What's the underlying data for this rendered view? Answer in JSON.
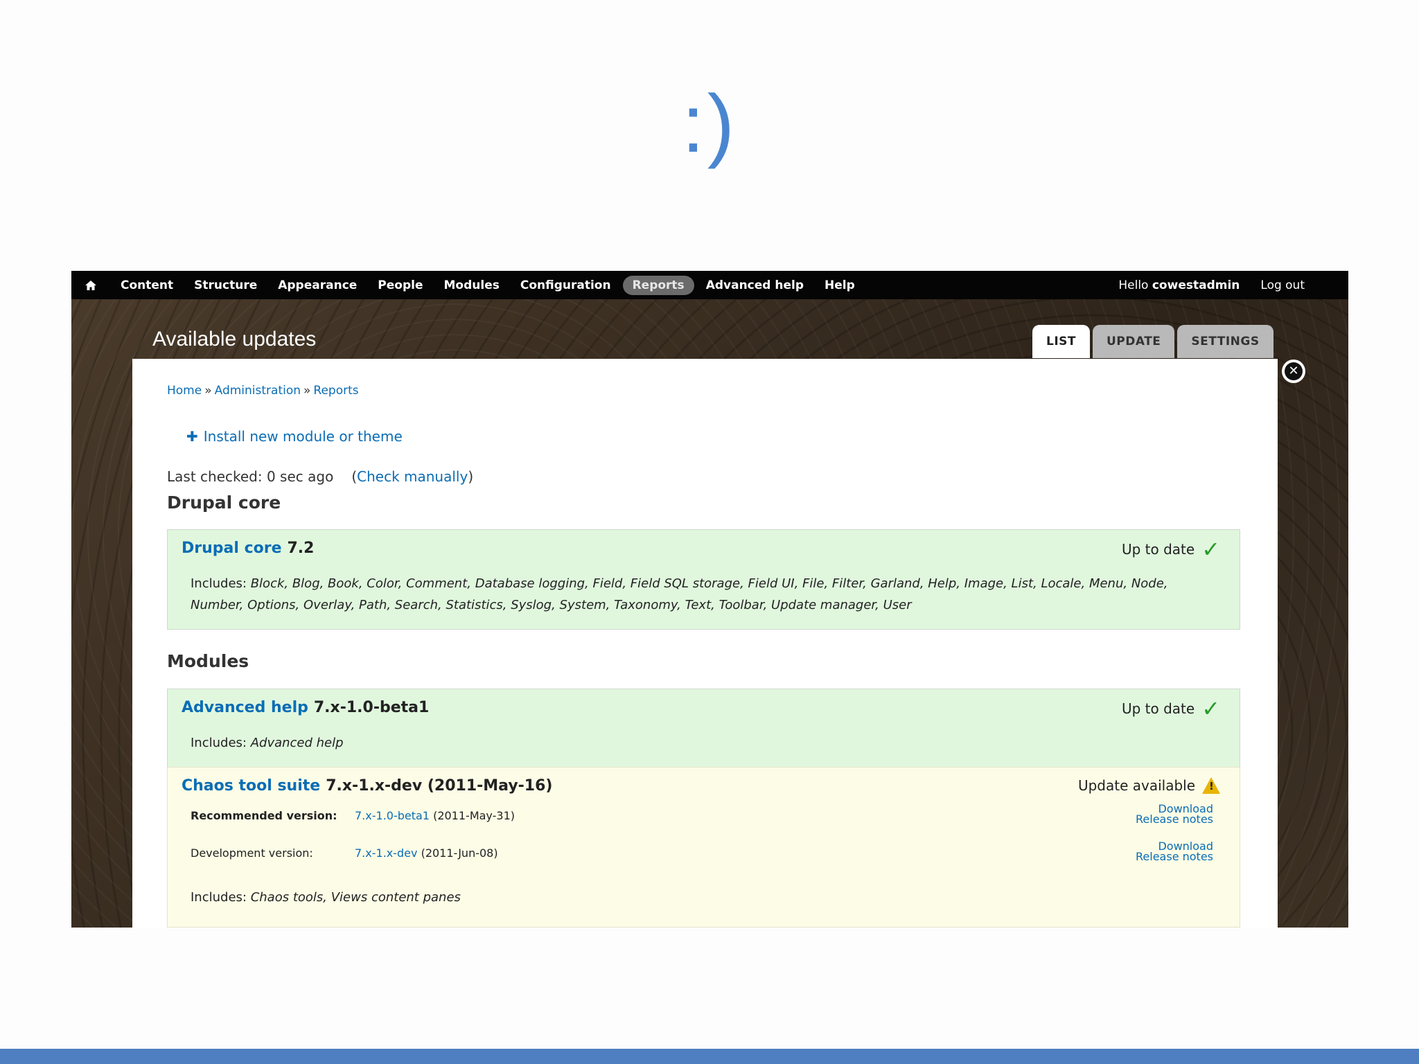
{
  "slide": {
    "title": ":)"
  },
  "toolbar": {
    "items": [
      "Content",
      "Structure",
      "Appearance",
      "People",
      "Modules",
      "Configuration",
      "Reports",
      "Advanced help",
      "Help"
    ],
    "active": "Reports",
    "greeting_prefix": "Hello ",
    "username": "cowestadmin",
    "logout": "Log out"
  },
  "header": {
    "title": "Available updates",
    "tabs": [
      "LIST",
      "UPDATE",
      "SETTINGS"
    ]
  },
  "breadcrumb": [
    "Home",
    "Administration",
    "Reports"
  ],
  "breadcrumb_sep": "»",
  "install_link": "Install new module or theme",
  "last_checked": "Last checked: 0 sec ago",
  "check_manually": "Check manually",
  "sections": {
    "core": "Drupal core",
    "modules": "Modules"
  },
  "projects": [
    {
      "name": "Drupal core",
      "version": "7.2",
      "status": "Up to date",
      "includes_label": "Includes:",
      "includes": "Block, Blog, Book, Color, Comment, Database logging, Field, Field SQL storage, Field UI, File, Filter, Garland, Help, Image, List, Locale, Menu, Node, Number, Options, Overlay, Path, Search, Statistics, Syslog, System, Taxonomy, Text, Toolbar, Update manager, User"
    },
    {
      "name": "Advanced help",
      "version": "7.x-1.0-beta1",
      "status": "Up to date",
      "includes_label": "Includes:",
      "includes": "Advanced help"
    },
    {
      "name": "Chaos tool suite",
      "version": "7.x-1.x-dev (2011-May-16)",
      "status": "Update available",
      "recommended_label": "Recommended version:",
      "recommended_version": "7.x-1.0-beta1",
      "recommended_date": "(2011-May-31)",
      "dev_label": "Development version:",
      "dev_version": "7.x-1.x-dev",
      "dev_date": "(2011-Jun-08)",
      "download": "Download",
      "release_notes": "Release notes",
      "includes_label": "Includes:",
      "includes": "Chaos tools, Views content panes"
    }
  ],
  "colors": {
    "ok_bg": "#e0f7de",
    "warn_bg": "#fdfce6",
    "link": "#0a6db5",
    "slide_accent": "#4a86d0"
  }
}
